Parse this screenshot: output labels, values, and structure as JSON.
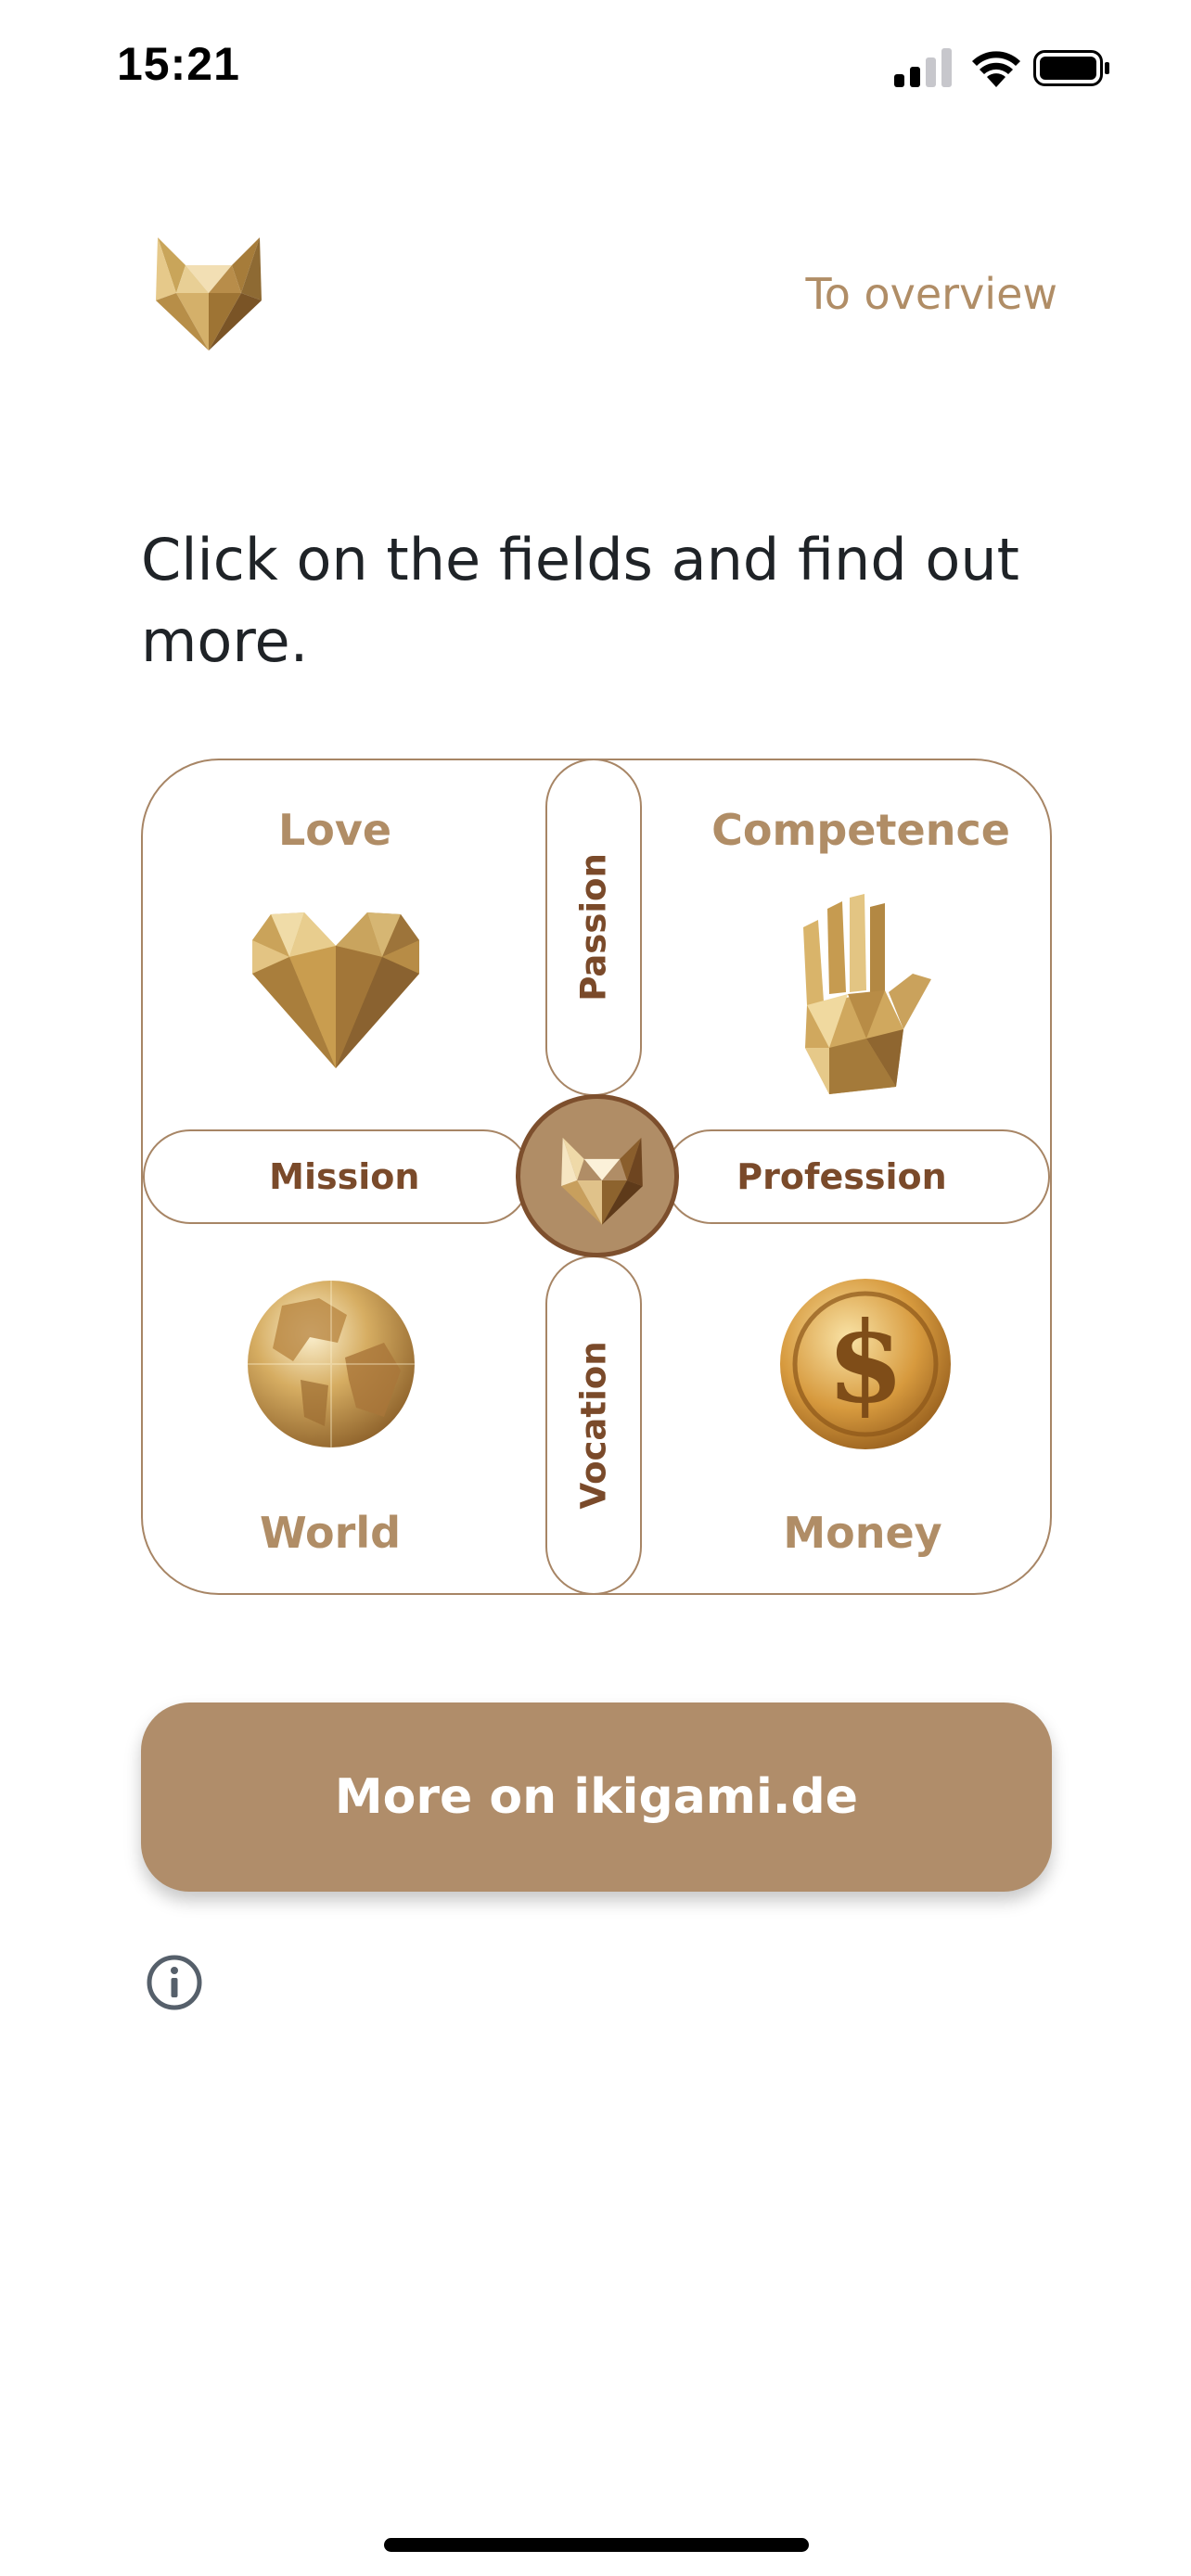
{
  "status_bar": {
    "time": "15:21"
  },
  "header": {
    "link_label": "To overview"
  },
  "headline": "Click on the fields and find out more.",
  "ikigai": {
    "quadrants": {
      "love": "Love",
      "competence": "Competence",
      "world": "World",
      "money": "Money"
    },
    "intersections": {
      "passion": "Passion",
      "vocation": "Vocation",
      "mission": "Mission",
      "profession": "Profession"
    }
  },
  "cta": {
    "label": "More on ikigami.de"
  },
  "colors": {
    "accent": "#b08d66",
    "dark_brown": "#7a4a2a",
    "border": "#a78565",
    "button": "#b08d6a",
    "text": "#1f2327"
  },
  "icons": [
    "fox-logo-icon",
    "heart-icon",
    "hand-icon",
    "globe-icon",
    "dollar-coin-icon",
    "info-icon"
  ]
}
